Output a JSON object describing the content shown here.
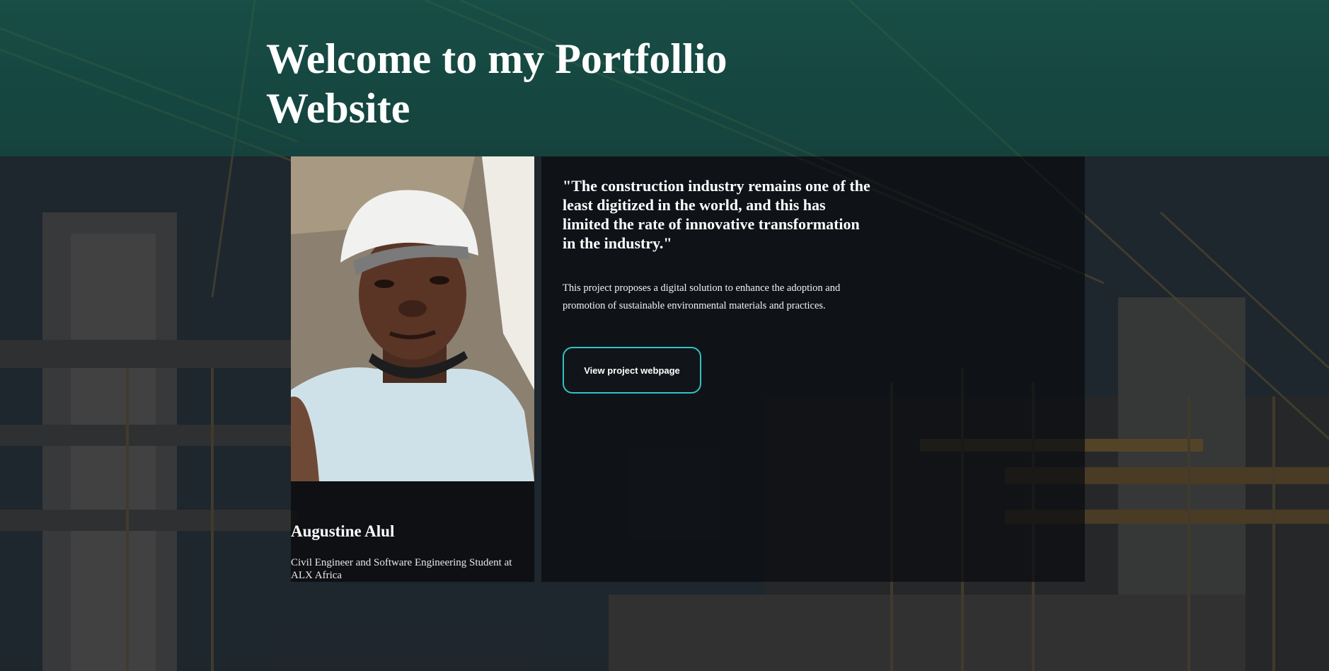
{
  "page": {
    "title": "Welcome to my Portfollio Website"
  },
  "profile": {
    "name": "Augustine Alul",
    "role": "Civil Engineer and Software Engineering Student at ALX Africa"
  },
  "project": {
    "quote": "\"The construction industry remains one of the least digitized in the world, and this has limited the rate of innovative transformation in the industry.\"",
    "description": "This project proposes a digital solution to enhance the adoption and promotion of sustainable environmental materials and practices.",
    "button_label": "View project webpage"
  },
  "colors": {
    "header_tint": "#125448",
    "button_border": "#2ec4c4",
    "panel_bg": "#0a0c10",
    "text": "#ffffff"
  },
  "icons": {
    "background": "construction-site-image",
    "portrait": "profile-photo"
  }
}
